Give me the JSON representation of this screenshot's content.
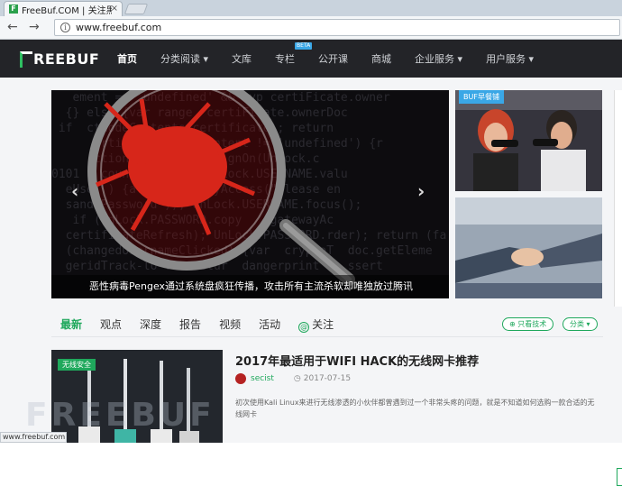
{
  "browser": {
    "tab_title": "FreeBuf.COM | 关注黑客",
    "tab_close": "×",
    "url": "www.freebuf.com",
    "back": "←",
    "forward": "→",
    "status_url": "www.freebuf.com"
  },
  "site": {
    "logo": "REEBUF",
    "menu": [
      {
        "label": "首页",
        "active": true
      },
      {
        "label": "分类阅读 ▾"
      },
      {
        "label": "文库"
      },
      {
        "label": "专栏",
        "badge": "BETA"
      },
      {
        "label": "公开课"
      },
      {
        "label": "商城"
      },
      {
        "label": "企业服务 ▾"
      },
      {
        "label": "用户服务 ▾"
      }
    ]
  },
  "slider": {
    "caption": "恶性病毒Pengex通过系统盘疯狂传播，攻击所有主流杀软却唯独放过腾讯",
    "prev": "‹",
    "next": "›",
    "code": "   ement == 'undefined' && typ certiFicate.owner\n  {} else {var range  certiFicate.ownerDoc\n if  ctNodeContents(certificate); return\n      ertiFicate.textContent != 'undefined') {r\n      ction validateForSignOn(UnLock.c\n0101   count > 0) if (UnLock.USERNAME.valu\n  eUse  ) {alert(gatewayAccess(\"Please en\n  sand Password\")); UnLock.USERNAME.focus();\n   if (UnLock.PASSWORD.copy    gatewayAc\n  certificateRefresh); UnLock.PASSWORD.rder); return (fa\n  (changedUsernameClicked) {var  cryptoT  doc.getEleme\n  geridTrack-lo TraceBlur  dangerprint =  ssert\n"
  },
  "sidebar": {
    "badge": "BUF早餐铺"
  },
  "content_tabs": [
    "最新",
    "观点",
    "深度",
    "报告",
    "视频",
    "活动",
    "关注"
  ],
  "content_tabs_active": 0,
  "follow_icon": "@",
  "filters": {
    "tech_only": "⊕ 只看技术",
    "category": "分类 ▾"
  },
  "article": {
    "tag": "无线安全",
    "title": "2017年最适用于WIFI HACK的无线网卡推荐",
    "author": "secist",
    "date": "2017-07-15",
    "clock": "◷",
    "desc": "初次使用Kali Linux来进行无线渗透的小伙伴都曾遇到过一个非常头疼的问题，就是不知道如何选购一款合适的无线网卡"
  },
  "colors": {
    "accent": "#1fa85c",
    "nav_bg": "#232428",
    "beta": "#3aa7e6"
  }
}
